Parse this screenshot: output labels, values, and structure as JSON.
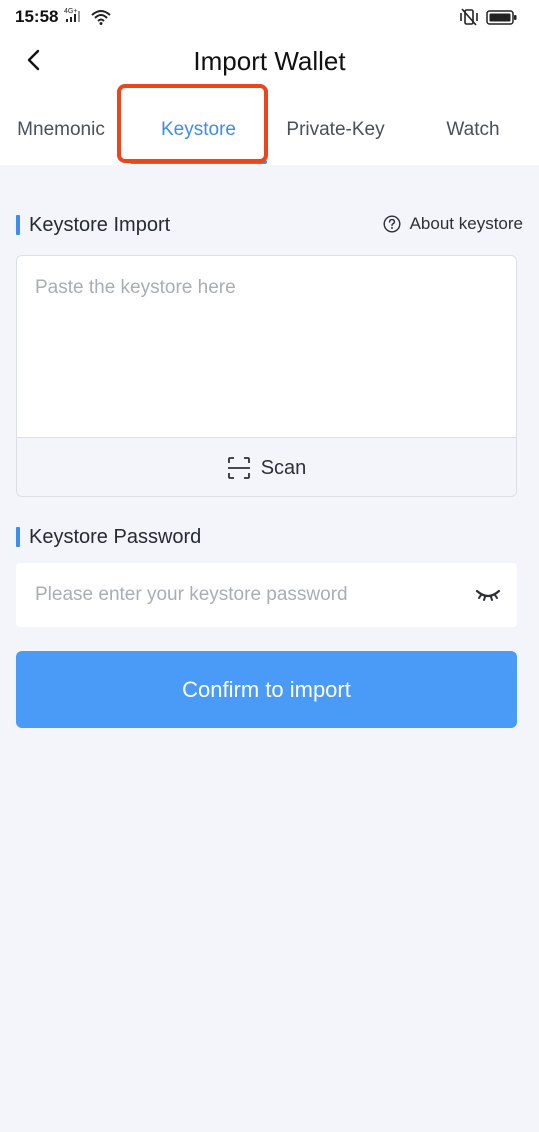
{
  "status_bar": {
    "time": "15:58",
    "network": "4G+"
  },
  "header": {
    "title": "Import Wallet",
    "back_icon": "chevron-left-icon"
  },
  "tabs": [
    {
      "label": "Mnemonic",
      "active": false
    },
    {
      "label": "Keystore",
      "active": true
    },
    {
      "label": "Private-Key",
      "active": false
    },
    {
      "label": "Watch",
      "active": false
    }
  ],
  "highlight": {
    "color": "#ee4419",
    "target": "tab-keystore"
  },
  "keystore_import": {
    "title": "Keystore Import",
    "about_label": "About keystore",
    "about_icon": "question-circle-icon",
    "textarea_placeholder": "Paste the keystore here",
    "textarea_value": "",
    "scan_label": "Scan",
    "scan_icon": "scan-frame-icon"
  },
  "keystore_password": {
    "title": "Keystore Password",
    "placeholder": "Please enter your keystore password",
    "value": "",
    "toggle_icon": "eye-closed-icon"
  },
  "confirm_button": {
    "label": "Confirm to import"
  },
  "colors": {
    "accent": "#3d8cf0",
    "button": "#4a9af7",
    "background": "#f4f5fa"
  }
}
